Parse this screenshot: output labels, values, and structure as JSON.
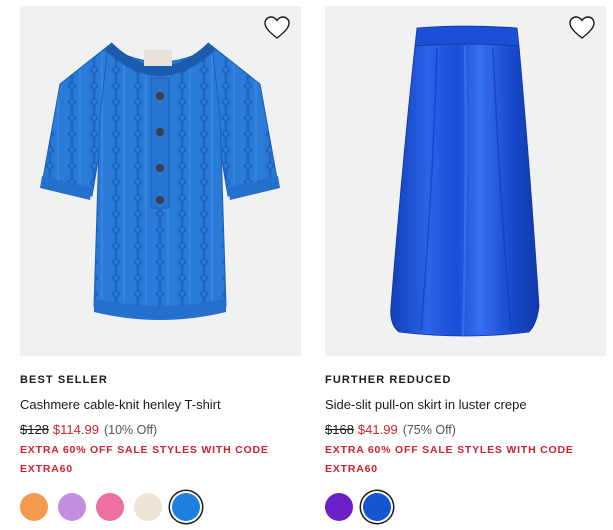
{
  "products": [
    {
      "badge": "BEST SELLER",
      "name": "Cashmere cable-knit henley T-shirt",
      "price_original": "$128",
      "price_sale": "$114.99",
      "price_off": "(10% Off)",
      "promo": "EXTRA 60% OFF SALE STYLES WITH CODE EXTRA60",
      "image_icon": "sweater-image",
      "swatches": [
        {
          "color": "#f39a4f",
          "selected": false
        },
        {
          "color": "#c48fe0",
          "selected": false
        },
        {
          "color": "#ef6fa3",
          "selected": false
        },
        {
          "color": "#ede4d6",
          "selected": false
        },
        {
          "color": "#1e7fe0",
          "selected": true
        }
      ]
    },
    {
      "badge": "FURTHER REDUCED",
      "name": "Side-slit pull-on skirt in luster crepe",
      "price_original": "$168",
      "price_sale": "$41.99",
      "price_off": "(75% Off)",
      "promo": "EXTRA 60% OFF SALE STYLES WITH CODE EXTRA60",
      "image_icon": "skirt-image",
      "swatches": [
        {
          "color": "#6a1fc8",
          "selected": false
        },
        {
          "color": "#1456d0",
          "selected": true
        }
      ]
    }
  ],
  "colors": {
    "sale_red": "#d2202f",
    "sweater_blue": "#2a7ad8",
    "skirt_blue": "#1a4fd6"
  }
}
